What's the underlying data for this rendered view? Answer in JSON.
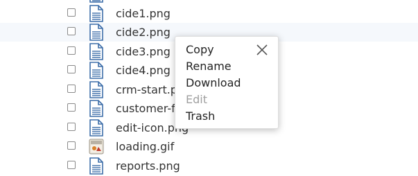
{
  "files": [
    {
      "name": "cide1.png",
      "icon": "document-icon"
    },
    {
      "name": "cide2.png",
      "icon": "document-icon"
    },
    {
      "name": "cide3.png",
      "icon": "document-icon"
    },
    {
      "name": "cide4.png",
      "icon": "document-icon"
    },
    {
      "name": "crm-start.p",
      "icon": "document-icon"
    },
    {
      "name": "customer-f",
      "icon": "document-icon"
    },
    {
      "name": "edit-icon.png",
      "icon": "document-icon"
    },
    {
      "name": "loading.gif",
      "icon": "image-thumbnail-icon"
    },
    {
      "name": "reports.png",
      "icon": "document-icon"
    }
  ],
  "context_menu": {
    "items": [
      {
        "label": "Copy",
        "enabled": true
      },
      {
        "label": "Rename",
        "enabled": true
      },
      {
        "label": "Download",
        "enabled": true
      },
      {
        "label": "Edit",
        "enabled": false
      },
      {
        "label": "Trash",
        "enabled": true
      }
    ],
    "close_icon": "close-icon"
  },
  "colors": {
    "text": "#333333",
    "disabled_text": "#a0a0a0",
    "hover_row": "#f5f8fc",
    "icon_blue": "#3c6da8"
  }
}
